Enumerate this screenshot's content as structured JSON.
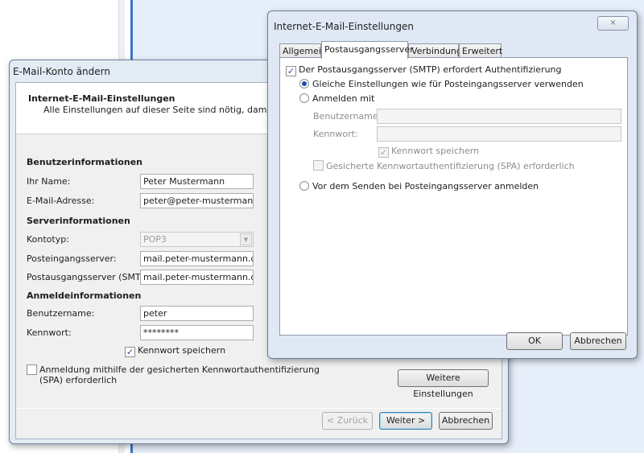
{
  "left_window": {
    "title": "E-Mail-Konto ändern",
    "header_title": "Internet-E-Mail-Einstellungen",
    "header_subtitle": "Alle Einstellungen auf dieser Seite sind nötig, damit Ihr Konto",
    "user_section": "Benutzerinformationen",
    "name_label": "Ihr Name:",
    "name_value": "Peter Mustermann",
    "email_label": "E-Mail-Adresse:",
    "email_value": "peter@peter-mustermann.de",
    "server_section": "Serverinformationen",
    "account_type_label": "Kontotyp:",
    "account_type_value": "POP3",
    "incoming_label": "Posteingangsserver:",
    "incoming_value": "mail.peter-mustermann.de",
    "outgoing_label": "Postausgangsserver (SMTP):",
    "outgoing_value": "mail.peter-mustermann.de",
    "login_section": "Anmeldeinformationen",
    "username_label": "Benutzername:",
    "username_value": "peter",
    "password_label": "Kennwort:",
    "password_value": "********",
    "save_password_label": "Kennwort speichern",
    "save_password_checked": true,
    "spa_label_line1": "Anmeldung mithilfe der gesicherten Kennwortauthentifizierung",
    "spa_label_line2": "(SPA) erforderlich",
    "spa_checked": false,
    "more_settings_button": "Weitere Einstellungen",
    "back_button": "< Zurück",
    "next_button": "Weiter >",
    "cancel_button": "Abbrechen"
  },
  "right_dialog": {
    "title": "Internet-E-Mail-Einstellungen",
    "close_glyph": "⨯",
    "tabs": [
      "Allgemein",
      "Postausgangsserver",
      "Verbindung",
      "Erweitert"
    ],
    "active_tab": "Postausgangsserver",
    "smtp_auth_label": "Der Postausgangsserver (SMTP) erfordert Authentifizierung",
    "smtp_auth_checked": true,
    "same_settings_label": "Gleiche Einstellungen wie für Posteingangsserver verwenden",
    "login_with_label": "Anmelden mit",
    "username_label": "Benutzername:",
    "username_value": "",
    "password_label": "Kennwort:",
    "password_value": "",
    "save_password_label": "Kennwort speichern",
    "spa_label": "Gesicherte Kennwortauthentifizierung (SPA) erforderlich",
    "pop_before_smtp_label": "Vor dem Senden bei Posteingangsserver anmelden",
    "ok_button": "OK",
    "cancel_button": "Abbrechen"
  },
  "colors": {
    "desktop_blue": "#e6eefa",
    "window_frame": "#e3ebf4",
    "accent_line": "#3c74c4"
  }
}
